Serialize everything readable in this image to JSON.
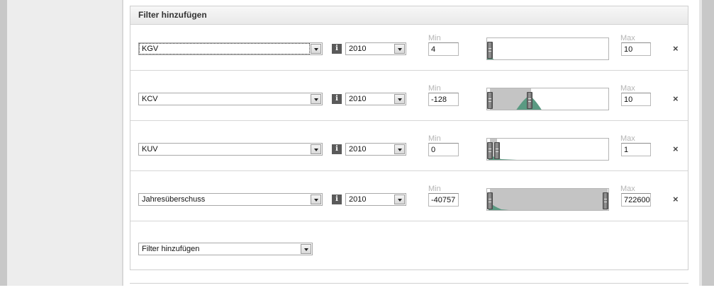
{
  "panel": {
    "title": "Filter hinzufügen"
  },
  "labels": {
    "min": "Min",
    "max": "Max",
    "info": "i",
    "remove": "×"
  },
  "filters": [
    {
      "metric": "KGV",
      "year": "2010",
      "min": "4",
      "max": "10",
      "range_start_frac": 0.0,
      "range_end_frac": 0.0
    },
    {
      "metric": "KCV",
      "year": "2010",
      "min": "-128",
      "max": "10",
      "range_start_frac": 0.0,
      "range_end_frac": 0.35
    },
    {
      "metric": "KUV",
      "year": "2010",
      "min": "0",
      "max": "1",
      "range_start_frac": 0.0,
      "range_end_frac": 0.06
    },
    {
      "metric": "Jahresüberschuss",
      "year": "2010",
      "min": "-40757",
      "max": "722600",
      "range_start_frac": 0.0,
      "range_end_frac": 1.0
    }
  ],
  "add_filter": {
    "placeholder": "Filter hinzufügen"
  },
  "colors": {
    "distribution": "#5a9a82",
    "selection": "#c4c4c4"
  }
}
